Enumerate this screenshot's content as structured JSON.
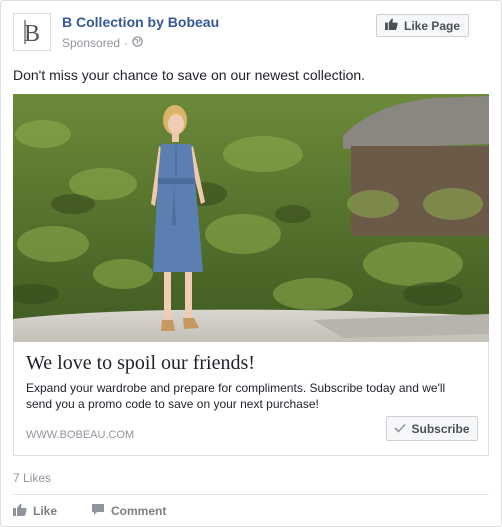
{
  "post": {
    "page_name": "B Collection by Bobeau",
    "sponsored_label": "Sponsored",
    "separator": "·",
    "like_page_label": "Like Page",
    "message": "Don't miss your chance to save on our newest collection.",
    "logo_letter": "B"
  },
  "attachment": {
    "headline": "We love to spoil our friends!",
    "description_lines": [
      "Expand your wardrobe and prepare for compliments. Subscribe today and we'll",
      "send you a promo code to save on your next purchase!"
    ],
    "domain": "WWW.BOBEAU.COM",
    "cta_label": "Subscribe"
  },
  "footer": {
    "likes_count": "7 Likes",
    "like_label": "Like",
    "comment_label": "Comment"
  },
  "colors": {
    "page_link": "#365899",
    "meta_gray": "#90949c",
    "button_bg": "#f6f7f9",
    "border": "#dddfe2",
    "dress_blue": "#5a7fb0",
    "foliage_green": "#5c7d2e"
  },
  "icons": {
    "like_page": "thumbs-up-icon",
    "audience": "globe-icon",
    "subscribe": "checkmark-icon",
    "like": "thumbs-up-icon",
    "comment": "comment-bubble-icon"
  }
}
